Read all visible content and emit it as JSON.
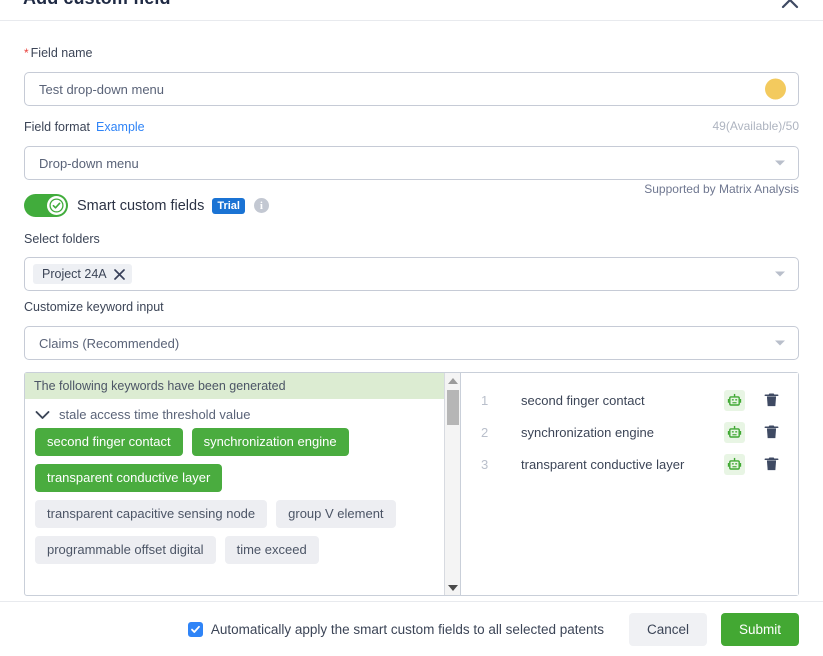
{
  "dialog": {
    "title": "Add custom field",
    "close_icon": "close-icon"
  },
  "field_name": {
    "label": "Field name",
    "required_mark": "*",
    "value": "Test drop-down menu",
    "color_swatch": "#f3c košut"
  },
  "field_format": {
    "label": "Field format",
    "example_link": "Example",
    "counter": "49(Available)/50",
    "value": "Drop-down menu",
    "supported_note": "Supported by Matrix Analysis"
  },
  "smart_fields": {
    "toggle_on": "on",
    "label": "Smart custom fields",
    "badge": "Trial",
    "info_icon": "info-icon"
  },
  "select_folders": {
    "label": "Select folders",
    "chips": [
      "Project 24A"
    ]
  },
  "keyword_input": {
    "label": "Customize keyword input",
    "value": "Claims (Recommended)"
  },
  "keywords_panel": {
    "banner": "The following keywords have been generated",
    "group_title": "stale access time threshold value",
    "tags": [
      {
        "text": "second finger contact",
        "selected": true
      },
      {
        "text": "synchronization engine",
        "selected": true
      },
      {
        "text": "transparent conductive layer",
        "selected": true
      },
      {
        "text": "transparent capacitive sensing node",
        "selected": false
      },
      {
        "text": "group V element",
        "selected": false
      },
      {
        "text": "programmable offset digital",
        "selected": false
      },
      {
        "text": "time exceed",
        "selected": false
      }
    ],
    "colors": {
      "selected_bg": "#4aac3f",
      "unselected_bg": "#edeef2",
      "banner_bg": "#dcecd2"
    }
  },
  "selected_keywords": {
    "rows": [
      {
        "num": "1",
        "name": "second finger contact"
      },
      {
        "num": "2",
        "name": "synchronization engine"
      },
      {
        "num": "3",
        "name": "transparent conductive layer"
      }
    ],
    "robot_icon": "robot-icon",
    "delete_icon": "trash-icon"
  },
  "footer": {
    "auto_apply_label": "Automatically apply the smart custom fields to all selected patents",
    "auto_apply_checked": true,
    "cancel_label": "Cancel",
    "submit_label": "Submit",
    "submit_color": "#43a833"
  }
}
